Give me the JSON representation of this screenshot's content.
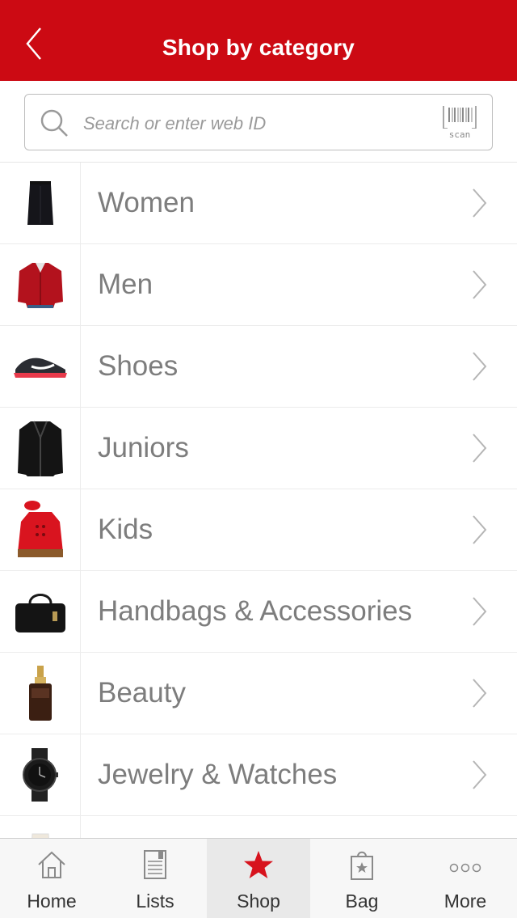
{
  "header": {
    "title": "Shop by category",
    "back_icon": "chevron-left-icon"
  },
  "search": {
    "placeholder": "Search or enter web ID",
    "scan_label": "scan"
  },
  "categories": [
    {
      "label": "Women",
      "icon": "skirt-icon"
    },
    {
      "label": "Men",
      "icon": "red-jacket-icon"
    },
    {
      "label": "Shoes",
      "icon": "sneaker-icon"
    },
    {
      "label": "Juniors",
      "icon": "leather-jacket-icon"
    },
    {
      "label": "Kids",
      "icon": "red-coat-icon"
    },
    {
      "label": "Handbags & Accessories",
      "icon": "handbag-icon"
    },
    {
      "label": "Beauty",
      "icon": "serum-bottle-icon"
    },
    {
      "label": "Jewelry & Watches",
      "icon": "watch-icon"
    }
  ],
  "tabs": [
    {
      "label": "Home",
      "icon": "home-icon"
    },
    {
      "label": "Lists",
      "icon": "list-icon"
    },
    {
      "label": "Shop",
      "icon": "star-icon",
      "active": true
    },
    {
      "label": "Bag",
      "icon": "shopping-bag-icon"
    },
    {
      "label": "More",
      "icon": "more-dots-icon"
    }
  ],
  "colors": {
    "brand_red": "#cc0a13",
    "label_gray": "#7d7d7d",
    "tab_bg": "#f7f7f7"
  }
}
